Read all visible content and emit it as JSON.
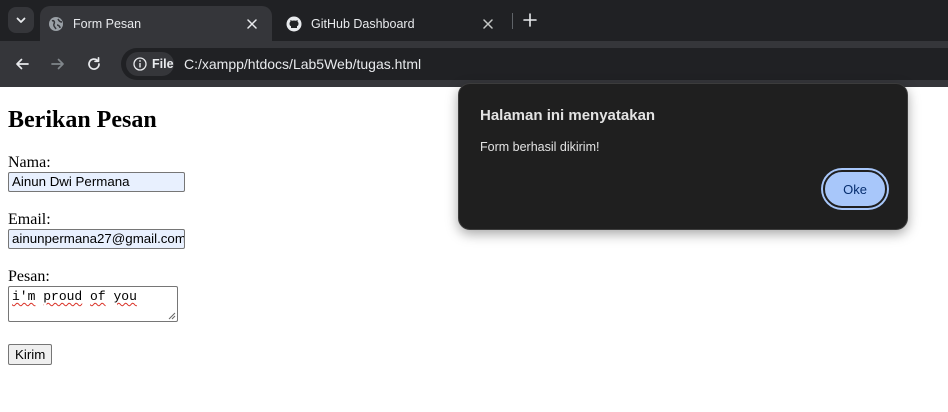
{
  "browser": {
    "tabs": [
      {
        "title": "Form Pesan",
        "active": true
      },
      {
        "title": "GitHub Dashboard",
        "active": false
      }
    ],
    "site_chip": "File",
    "url": "C:/xampp/htdocs/Lab5Web/tugas.html"
  },
  "page": {
    "title": "Berikan Pesan",
    "name_label": "Nama:",
    "name_value": "Ainun Dwi Permana",
    "email_label": "Email:",
    "email_value": "ainunpermana27@gmail.com",
    "message_label": "Pesan:",
    "message_words": [
      "i'm",
      "proud",
      "of",
      "you"
    ],
    "submit_label": "Kirim"
  },
  "dialog": {
    "title": "Halaman ini menyatakan",
    "message": "Form berhasil dikirim!",
    "ok_label": "Oke"
  },
  "colors": {
    "chrome_dark": "#202124",
    "chrome_toolbar": "#35363a",
    "autofill_bg": "#e8f0fe",
    "dialog_bg": "#1f1f1f",
    "dialog_button": "#a8c7fa"
  },
  "icons": [
    "chevron-down-icon",
    "globe-icon",
    "close-icon",
    "github-icon",
    "plus-icon",
    "back-arrow-icon",
    "forward-arrow-icon",
    "reload-icon",
    "info-icon"
  ]
}
